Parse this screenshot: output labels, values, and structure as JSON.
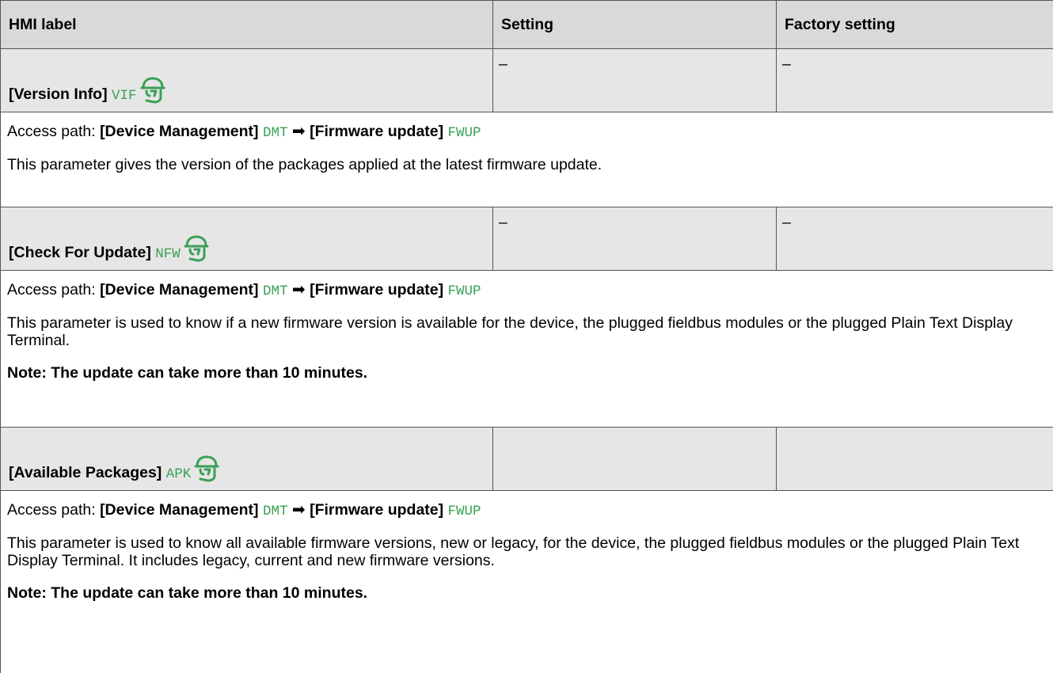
{
  "headers": {
    "hmi_label": "HMI label",
    "setting": "Setting",
    "factory_setting": "Factory setting"
  },
  "icon_color": "#3aa055",
  "params": [
    {
      "label": "[Version Info]",
      "code": "VIF",
      "setting": "–",
      "factory": "–",
      "access_prefix": "Access path:",
      "access_menu1": "[Device Management]",
      "access_code1": "DMT",
      "access_menu2": "[Firmware update]",
      "access_code2": "FWUP",
      "description": "This parameter gives the version of the packages applied at the latest firmware update.",
      "note": ""
    },
    {
      "label": "[Check For Update]",
      "code": "NFW",
      "setting": "–",
      "factory": "–",
      "access_prefix": "Access path:",
      "access_menu1": "[Device Management]",
      "access_code1": "DMT",
      "access_menu2": "[Firmware update]",
      "access_code2": "FWUP",
      "description": "This parameter is used to know if a new firmware version is available for the device, the plugged fieldbus modules or the plugged Plain Text Display Terminal.",
      "note": "Note: The update can take more than 10 minutes."
    },
    {
      "label": "[Available Packages]",
      "code": "APK",
      "setting": "",
      "factory": "",
      "access_prefix": "Access path:",
      "access_menu1": "[Device Management]",
      "access_code1": "DMT",
      "access_menu2": "[Firmware update]",
      "access_code2": "FWUP",
      "description": "This parameter is used to know all available firmware versions, new or legacy, for the device, the plugged fieldbus modules or the plugged Plain Text Display Terminal. It includes legacy, current and new firmware versions.",
      "note": "Note: The update can take more than 10 minutes."
    }
  ]
}
